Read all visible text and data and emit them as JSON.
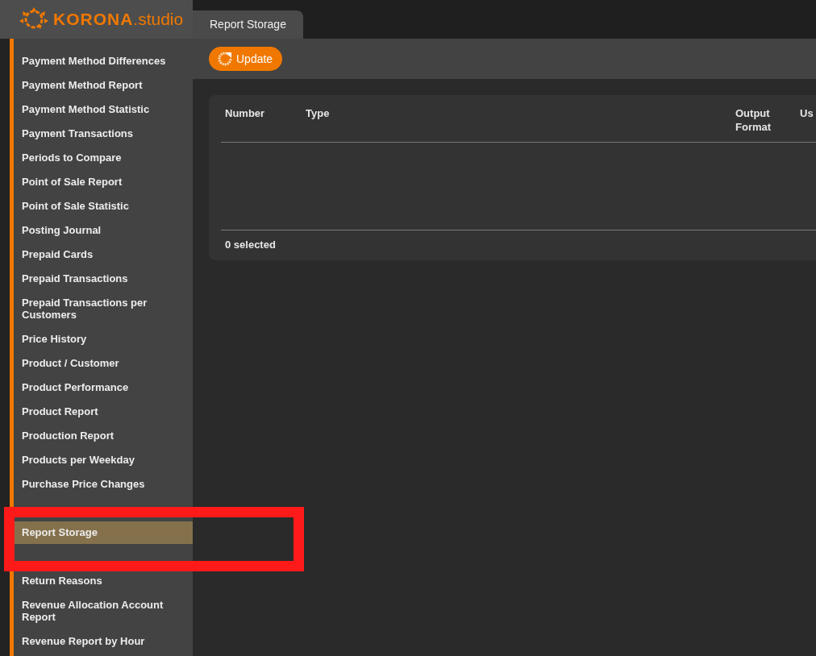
{
  "logo": {
    "brand": "KORONA",
    "suffix": ".studio"
  },
  "sidebar": {
    "items": [
      {
        "kind": "gap"
      },
      {
        "kind": "item",
        "label": "Payment Method Differences",
        "selected": false
      },
      {
        "kind": "item",
        "label": "Payment Method Report",
        "selected": false
      },
      {
        "kind": "item",
        "label": "Payment Method Statistic",
        "selected": false
      },
      {
        "kind": "item",
        "label": "Payment Transactions",
        "selected": false
      },
      {
        "kind": "item",
        "label": "Periods to Compare",
        "selected": false
      },
      {
        "kind": "item",
        "label": "Point of Sale Report",
        "selected": false
      },
      {
        "kind": "item",
        "label": "Point of Sale Statistic",
        "selected": false
      },
      {
        "kind": "item",
        "label": "Posting Journal",
        "selected": false
      },
      {
        "kind": "item",
        "label": "Prepaid Cards",
        "selected": false
      },
      {
        "kind": "item",
        "label": "Prepaid Transactions",
        "selected": false
      },
      {
        "kind": "item",
        "label": "Prepaid Transactions per Customers",
        "selected": false
      },
      {
        "kind": "item",
        "label": "Price History",
        "selected": false
      },
      {
        "kind": "item",
        "label": "Product / Customer",
        "selected": false
      },
      {
        "kind": "item",
        "label": "Product Performance",
        "selected": false
      },
      {
        "kind": "item",
        "label": "Product Report",
        "selected": false
      },
      {
        "kind": "item",
        "label": "Production Report",
        "selected": false
      },
      {
        "kind": "item",
        "label": "Products per Weekday",
        "selected": false
      },
      {
        "kind": "item",
        "label": "Purchase Price Changes",
        "selected": false
      },
      {
        "kind": "gap"
      },
      {
        "kind": "item",
        "label": "Report Storage",
        "selected": true
      },
      {
        "kind": "gap"
      },
      {
        "kind": "item",
        "label": "Return Reasons",
        "selected": false
      },
      {
        "kind": "item",
        "label": "Revenue Allocation Account Report",
        "selected": false
      },
      {
        "kind": "item",
        "label": "Revenue Report by Hour",
        "selected": false
      }
    ]
  },
  "tabs": [
    {
      "label": "Report Storage",
      "selected": true
    }
  ],
  "toolbar": {
    "buttons": [
      {
        "label": "Update"
      }
    ]
  },
  "table": {
    "columns": [
      "Number",
      "Type",
      "Output Format",
      "Us"
    ],
    "footer": "0 selected"
  },
  "annotation": {
    "kind": "highlight-frame"
  }
}
